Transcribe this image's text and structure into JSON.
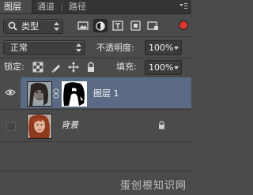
{
  "tabs": [
    {
      "label": "图层",
      "active": true
    },
    {
      "label": "通道",
      "active": false
    },
    {
      "label": "路径",
      "active": false
    }
  ],
  "filter": {
    "label": "类型",
    "icon": "search-icon"
  },
  "filter_icons": [
    "image-filter-icon",
    "adjustment-filter-icon",
    "type-filter-icon",
    "shape-filter-icon",
    "smart-object-filter-icon"
  ],
  "blend_mode": "正常",
  "opacity": {
    "label": "不透明度:",
    "value": "100%"
  },
  "lock": {
    "label": "锁定:",
    "icons": [
      "lock-transparent-icon",
      "lock-image-icon",
      "lock-position-icon",
      "lock-all-icon"
    ]
  },
  "fill": {
    "label": "填充:",
    "value": "100%"
  },
  "layers": [
    {
      "name": "图层 1",
      "visible": true,
      "selected": true,
      "has_mask": true
    },
    {
      "name": "背景",
      "visible": false,
      "selected": false,
      "locked": true
    }
  ],
  "colors": {
    "selected_row": "#5a6a85",
    "panel_bg": "#4b4b4b",
    "filter_toggle": "#d63a2e"
  },
  "watermark": "蛋创根知识网"
}
